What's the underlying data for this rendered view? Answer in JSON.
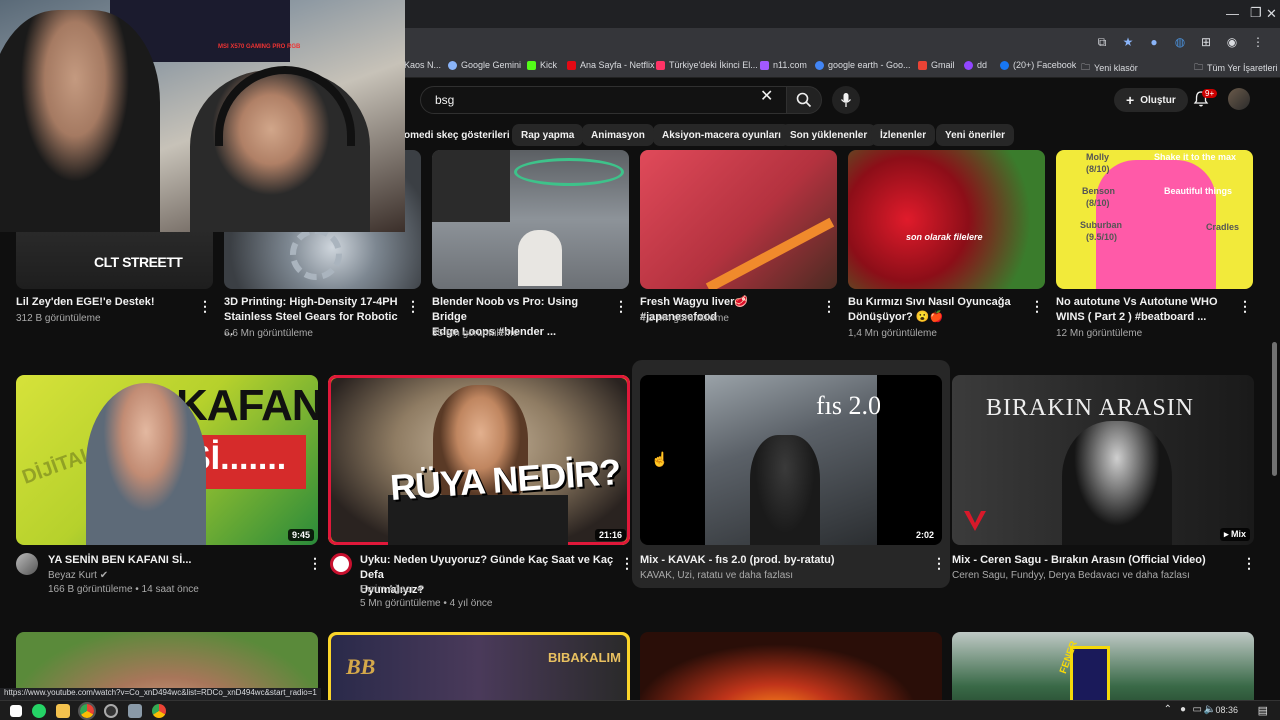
{
  "browser": {
    "bookmarks": [
      {
        "label": "Kaos N...",
        "color": "#4a90d9"
      },
      {
        "label": "Google Gemini",
        "color": "#8ab4f8"
      },
      {
        "label": "Kick",
        "color": "#53fc18"
      },
      {
        "label": "Ana Sayfa - Netflix",
        "color": "#e50914"
      },
      {
        "label": "Türkiye'deki İkinci El...",
        "color": "#ff3366"
      },
      {
        "label": "n11.com",
        "color": "#a259ff"
      },
      {
        "label": "google earth - Goo...",
        "color": "#4285f4"
      },
      {
        "label": "Gmail",
        "color": "#ea4335"
      },
      {
        "label": "dd",
        "color": "#9146ff"
      },
      {
        "label": "(20+) Facebook",
        "color": "#1877f2"
      },
      {
        "label": "Yeni klasör",
        "color": "#dadce0"
      }
    ],
    "all_bookmarks": "Tüm Yer İşaretleri",
    "status_url": "https://www.youtube.com/watch?v=Co_xnD494wc&list=RDCo_xnD494wc&start_radio=1"
  },
  "header": {
    "search_value": "bsg",
    "create_label": "Oluştur",
    "notif_badge": "9+"
  },
  "chips": [
    "omedi skeç gösterileri",
    "Rap yapma",
    "Animasyon",
    "Aksiyon-macera oyunları",
    "Son yüklenenler",
    "İzlenenler",
    "Yeni öneriler"
  ],
  "webcam": {
    "monitor_text": "MSI X570 GAMING PRO RGB"
  },
  "row1": [
    {
      "title1": "Lil Zey'den EGE!'e Destek!",
      "title2": "",
      "meta1": "312 B görüntüleme",
      "thumb_text": "CLT STREETT"
    },
    {
      "title1": "3D Printing: High-Density 17-4PH",
      "title2": "Stainless Steel Gears for Robotic ...",
      "meta1": "6,6 Mn görüntüleme"
    },
    {
      "title1": "Blender Noob vs Pro: Using Bridge",
      "title2": "Edge Loops #blender ...",
      "meta1": "35 Mn görüntüleme"
    },
    {
      "title1": "Fresh Wagyu liver🥩 #japanesefood",
      "title2": "",
      "meta1": "4,3 Mn görüntüleme"
    },
    {
      "title1": "Bu Kırmızı Sıvı Nasıl Oyuncağa",
      "title2": "Dönüşüyor? 😮🍎",
      "meta1": "1,4 Mn görüntüleme",
      "thumb_text": "son olarak filelere"
    },
    {
      "title1": "No autotune Vs Autotune WHO",
      "title2": "WINS ( Part 2 )  #beatboard ...",
      "meta1": "12 Mn görüntüleme",
      "thumb_lines": [
        "Molly",
        "(8/10)",
        "Benson",
        "(8/10)",
        "Suburban",
        "(9.5/10)",
        "Shake it to the max",
        "Beautiful things",
        "Cradles"
      ]
    }
  ],
  "row2": [
    {
      "title1": "YA SENİN BEN KAFANI Sİ...",
      "title2": "",
      "channel": "Beyaz Kurt ✔",
      "meta": "166 B görüntüleme • 14 saat önce",
      "duration": "9:45",
      "thumb_big": "KAFANI",
      "thumb_small": "Sİ.......",
      "thumb_side": "DİJİTAL BA"
    },
    {
      "title1": "Uyku: Neden Uyuyoruz? Günde Kaç Saat ve Kaç Defa",
      "title2": "Uyumalıyız?",
      "channel": "Evrim Ağacı ✔",
      "meta": "5 Mn görüntüleme • 4 yıl önce",
      "duration": "21:16",
      "thumb_big": "RÜYA NEDİR?"
    },
    {
      "title1": "Mix - KAVAK - fıs 2.0 (prod. by-ratatu)",
      "title2": "",
      "channel": "KAVAK, Uzi, ratatu ve daha fazlası",
      "duration": "2:02",
      "thumb_big": "fıs 2.0"
    },
    {
      "title1": "Mix - Ceren Sagu - Bırakın Arasın (Official Video)",
      "title2": "",
      "channel": "Ceren Sagu, Fundyy, Derya Bedavacı ve daha fazlası",
      "duration": "▸ Mix",
      "thumb_big": "BIRAKIN ARASIN"
    }
  ],
  "row3": [
    {
      "thumb_text": ""
    },
    {
      "thumb_text": "BIBAKALIM",
      "thumb_logo": "BB"
    },
    {
      "thumb_text": ""
    },
    {
      "thumb_text": "FENER"
    }
  ],
  "taskbar": {
    "time": "08:36"
  }
}
